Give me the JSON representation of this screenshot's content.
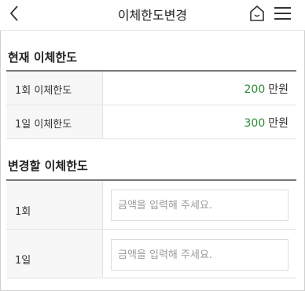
{
  "header": {
    "title": "이체한도변경",
    "icons": {
      "back": "chevron-left-icon",
      "home": "home-icon",
      "menu": "hamburger-menu-icon"
    }
  },
  "current_limit": {
    "title": "현재 이체한도",
    "rows": [
      {
        "label": "1회 이체한도",
        "value": "200",
        "unit": "만원"
      },
      {
        "label": "1일 이체한도",
        "value": "300",
        "unit": "만원"
      }
    ]
  },
  "change_limit": {
    "title": "변경할 이체한도",
    "rows": [
      {
        "label": "1회",
        "placeholder": "금액을 입력해 주세요.",
        "value": ""
      },
      {
        "label": "1일",
        "placeholder": "금액을 입력해 주세요.",
        "value": ""
      }
    ]
  },
  "colors": {
    "value_green": "#2e8b37",
    "rule": "#777777",
    "label_bg": "#f7f7f7"
  }
}
